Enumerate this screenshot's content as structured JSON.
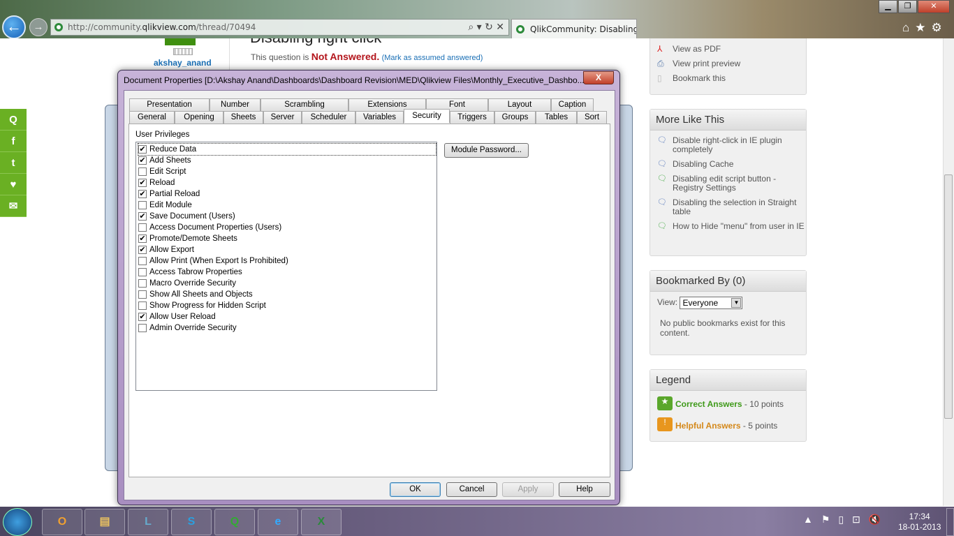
{
  "browser": {
    "url_prefix": "http://community.",
    "url_domain": "qlikview.com",
    "url_path": "/thread/70494",
    "tab_title": "QlikCommunity: Disabling ...",
    "tools": "⌕ ▾ ↻ ✕"
  },
  "page": {
    "username": "akshay_anand",
    "thread_title": "Disabling right click",
    "status_prefix": "This question is ",
    "status": "Not Answered.",
    "mark_link": "(Mark as assumed answered)"
  },
  "actions": [
    "View as PDF",
    "View print preview",
    "Bookmark this"
  ],
  "more_like_this": {
    "title": "More Like This",
    "items": [
      "Disable right-click in IE plugin completely",
      "Disabling Cache",
      "Disabling edit script button - Registry Settings",
      "Disabling the selection in Straight table",
      "How to Hide \"menu\" from user in IE"
    ]
  },
  "bookmarked": {
    "title": "Bookmarked By (0)",
    "view_label": "View:",
    "view_value": "Everyone",
    "empty": "No public bookmarks exist for this content."
  },
  "legend": {
    "title": "Legend",
    "correct": "Correct Answers",
    "correct_pts": " - 10 points",
    "helpful": "Helpful Answers",
    "helpful_pts": " - 5 points"
  },
  "dialog": {
    "title": "Document Properties [D:\\Akshay Anand\\Dashboards\\Dashboard Revision\\MED\\Qlikview Files\\Monthly_Executive_Dashbo...",
    "close": "X",
    "tabs_row1": [
      "Presentation",
      "Number",
      "Scrambling",
      "Extensions",
      "Font",
      "Layout",
      "Caption"
    ],
    "tabs_row2": [
      "General",
      "Opening",
      "Sheets",
      "Server",
      "Scheduler",
      "Variables",
      "Security",
      "Triggers",
      "Groups",
      "Tables",
      "Sort"
    ],
    "active_tab": "Security",
    "section_label": "User Privileges",
    "privileges": [
      {
        "label": "Reduce Data",
        "checked": true
      },
      {
        "label": "Add Sheets",
        "checked": true
      },
      {
        "label": "Edit Script",
        "checked": false
      },
      {
        "label": "Reload",
        "checked": true
      },
      {
        "label": "Partial Reload",
        "checked": true
      },
      {
        "label": "Edit Module",
        "checked": false
      },
      {
        "label": "Save Document (Users)",
        "checked": true
      },
      {
        "label": "Access Document Properties (Users)",
        "checked": false
      },
      {
        "label": "Promote/Demote Sheets",
        "checked": true
      },
      {
        "label": "Allow Export",
        "checked": true
      },
      {
        "label": "Allow Print (When Export Is Prohibited)",
        "checked": false
      },
      {
        "label": "Access Tabrow Properties",
        "checked": false
      },
      {
        "label": "Macro Override Security",
        "checked": false
      },
      {
        "label": "Show All Sheets and Objects",
        "checked": false
      },
      {
        "label": "Show Progress for Hidden Script",
        "checked": false
      },
      {
        "label": "Allow User Reload",
        "checked": true
      },
      {
        "label": "Admin Override Security",
        "checked": false
      }
    ],
    "module_password": "Module Password...",
    "ok": "OK",
    "cancel": "Cancel",
    "apply": "Apply",
    "help": "Help"
  },
  "taskbar": {
    "time": "17:34",
    "date": "18-01-2013"
  }
}
